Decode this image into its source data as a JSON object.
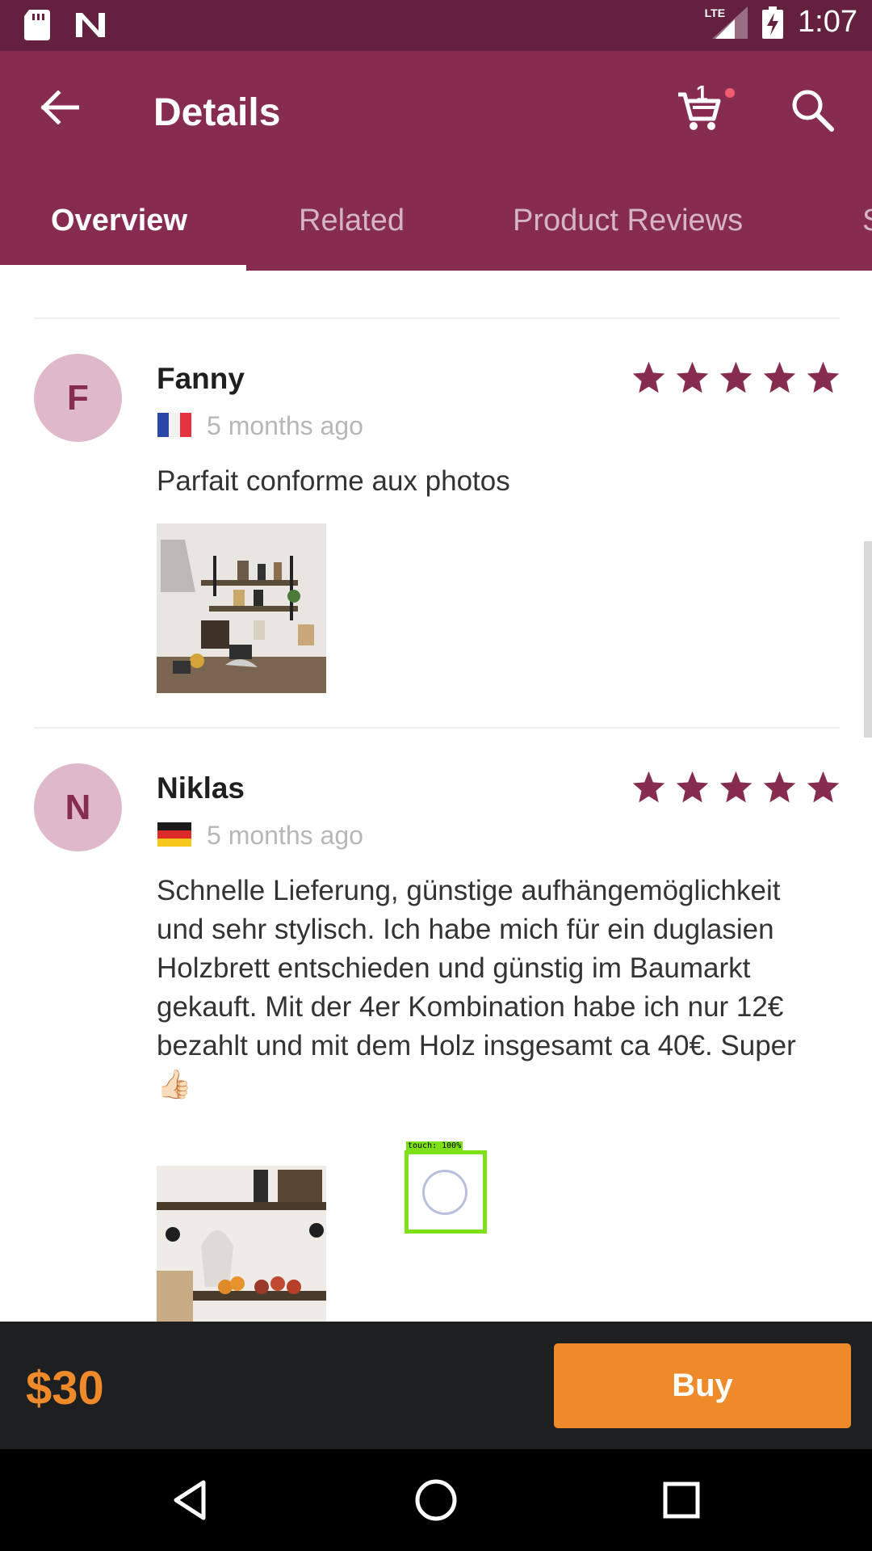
{
  "status_bar": {
    "time": "1:07",
    "network": "LTE",
    "icons": [
      "sd-card-icon",
      "notification-n-icon",
      "signal-icon",
      "battery-charging-icon"
    ]
  },
  "app_bar": {
    "title": "Details",
    "cart_count": "1",
    "icons": [
      "back-arrow-icon",
      "cart-icon",
      "search-icon"
    ]
  },
  "tabs": [
    {
      "label": "Overview",
      "active": true
    },
    {
      "label": "Related",
      "active": false
    },
    {
      "label": "Product Reviews",
      "active": false
    },
    {
      "label": "S",
      "active": false
    }
  ],
  "reviews": [
    {
      "initial": "F",
      "name": "Fanny",
      "country": "France",
      "date": "5 months ago",
      "rating": 5,
      "text": "Parfait conforme aux photos"
    },
    {
      "initial": "N",
      "name": "Niklas",
      "country": "Germany",
      "date": "5 months ago",
      "rating": 5,
      "text": "Schnelle Lieferung, günstige aufhängemöglichkeit und sehr stylisch. Ich habe mich für ein duglasien Holzbrett entschieden und günstig im Baumarkt gekauft. Mit der 4er Kombination habe ich nur 12€ bezahlt und mit dem Holz insgesamt ca 40€. Super 👍🏻"
    }
  ],
  "touch_indicator": {
    "label": "touch: 100%"
  },
  "purchase_bar": {
    "price": "$30",
    "buy_label": "Buy"
  },
  "colors": {
    "brand": "#862c51",
    "status_bar": "#63213f",
    "accent": "#ef8a2b",
    "avatar_bg": "#dfb9cb"
  },
  "nav_bar": {
    "icons": [
      "nav-back-icon",
      "nav-home-icon",
      "nav-recents-icon"
    ]
  }
}
